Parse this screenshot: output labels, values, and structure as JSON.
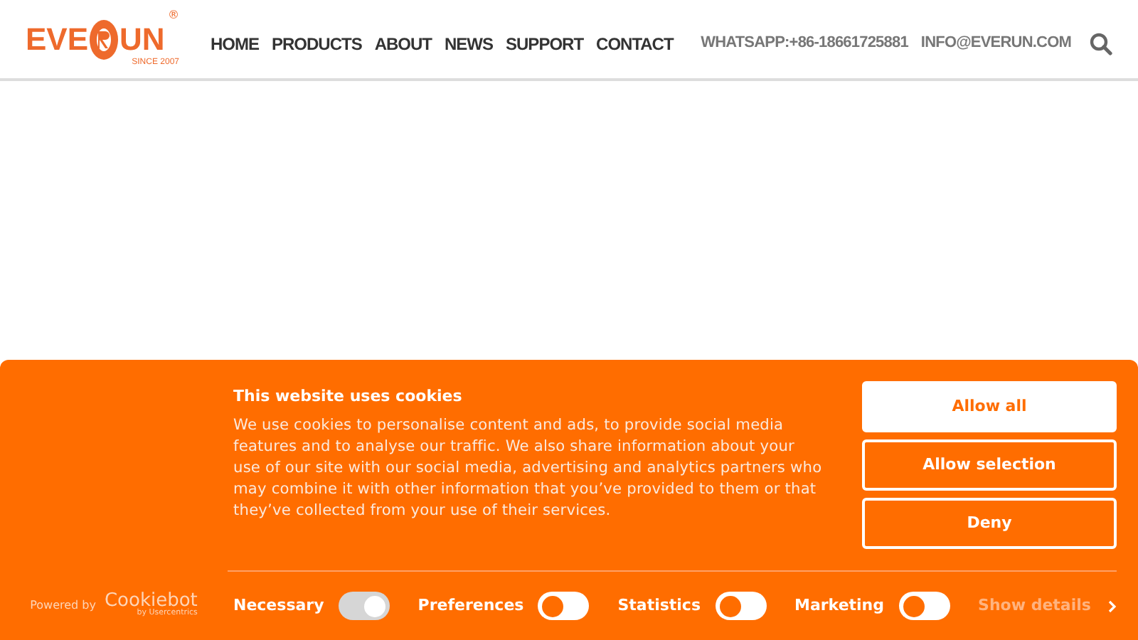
{
  "header": {
    "logo": {
      "left": "EVE",
      "right": "UN",
      "tagline": "SINCE 2007",
      "mark": "®"
    },
    "nav": [
      {
        "label": "HOME"
      },
      {
        "label": "PRODUCTS"
      },
      {
        "label": "ABOUT"
      },
      {
        "label": "NEWS"
      },
      {
        "label": "SUPPORT"
      },
      {
        "label": "CONTACT"
      }
    ],
    "whatsapp": "WHATSAPP:+86-18661725881",
    "email": "INFO@EVERUN.COM"
  },
  "cookie_banner": {
    "powered_by": "Powered by",
    "brand": "Cookiebot",
    "brand_sub": "by Usercentrics",
    "title": "This website uses cookies",
    "body": "We use cookies to personalise content and ads, to provide social media features and to analyse our traffic. We also share information about your use of our site with our social media, advertising and analytics partners who may combine it with other information that you’ve provided to them or that they’ve collected from your use of their services.",
    "buttons": [
      {
        "label": "Allow all",
        "kind": "primary"
      },
      {
        "label": "Allow selection",
        "kind": "outline"
      },
      {
        "label": "Deny",
        "kind": "outline"
      }
    ],
    "toggles": [
      {
        "label": "Necessary",
        "on": true,
        "disabled": true
      },
      {
        "label": "Preferences",
        "on": false,
        "disabled": false
      },
      {
        "label": "Statistics",
        "on": false,
        "disabled": false
      },
      {
        "label": "Marketing",
        "on": false,
        "disabled": false
      }
    ],
    "details_link": "Show details"
  }
}
